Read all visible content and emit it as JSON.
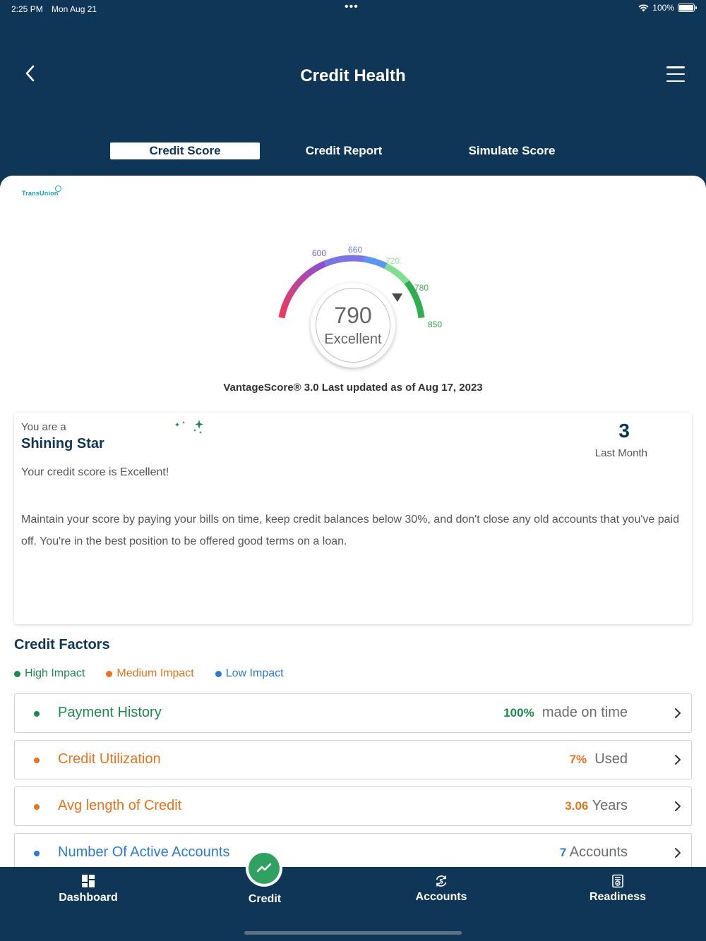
{
  "status_bar": {
    "time": "2:25 PM",
    "date": "Mon Aug 21",
    "battery": "100%"
  },
  "header": {
    "title": "Credit Health"
  },
  "tabs": [
    {
      "label": "Credit Score",
      "active": true
    },
    {
      "label": "Credit Report",
      "active": false
    },
    {
      "label": "Simulate Score",
      "active": false
    }
  ],
  "bureau": {
    "name": "TransUnion"
  },
  "gauge": {
    "ticks": [
      "600",
      "660",
      "720",
      "780",
      "850"
    ],
    "score": "790",
    "rating": "Excellent",
    "score_value": 790,
    "range": [
      300,
      850
    ]
  },
  "vantage_text": "VantageScore® 3.0 Last updated as of Aug 17, 2023",
  "summary": {
    "prefix": "You are a",
    "title": "Shining Star",
    "month_value": "3",
    "month_label": "Last Month",
    "headline": "Your credit score is Excellent!",
    "description": "Maintain your score by paying your bills on time, keep credit balances below 30%, and don't close any old accounts that you've paid off. You're in the best position to be offered good terms on a loan."
  },
  "credit_factors": {
    "title": "Credit Factors",
    "legend": [
      {
        "label": "High Impact",
        "color": "#1b8a4a"
      },
      {
        "label": "Medium Impact",
        "color": "#e8731a"
      },
      {
        "label": "Low Impact",
        "color": "#2b7bd6"
      }
    ],
    "items": [
      {
        "name": "Payment History",
        "value": "100%",
        "suffix": "made on time",
        "color": "#1b8a4a"
      },
      {
        "name": "Credit Utilization",
        "value": "7%",
        "suffix": "Used",
        "color": "#e8731a"
      },
      {
        "name": "Avg length of Credit",
        "value": "3.06",
        "suffix": "Years",
        "color": "#e8731a"
      },
      {
        "name": "Number Of Active Accounts",
        "value": "7",
        "suffix": "Accounts",
        "color": "#2b7bd6"
      }
    ]
  },
  "bottom_nav": [
    {
      "label": "Dashboard",
      "icon": "dashboard-icon"
    },
    {
      "label": "Credit",
      "icon": "trend-icon",
      "active": true
    },
    {
      "label": "Accounts",
      "icon": "accounts-icon"
    },
    {
      "label": "Readiness",
      "icon": "readiness-icon"
    }
  ],
  "colors": {
    "navy": "#0f3557",
    "green": "#1b8a4a",
    "orange": "#e8731a",
    "blue": "#2b7bd6"
  }
}
